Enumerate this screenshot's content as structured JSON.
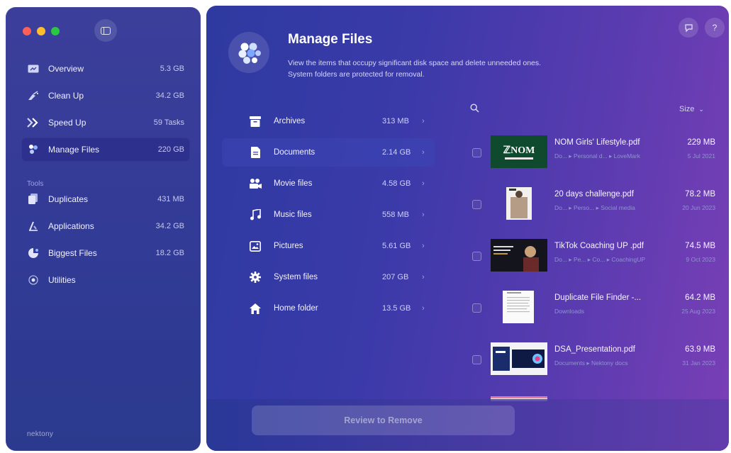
{
  "sidebar": {
    "items": [
      {
        "label": "Overview",
        "value": "5.3 GB",
        "icon": "overview-icon"
      },
      {
        "label": "Clean Up",
        "value": "34.2 GB",
        "icon": "broom-icon"
      },
      {
        "label": "Speed Up",
        "value": "59 Tasks",
        "icon": "speed-icon"
      },
      {
        "label": "Manage Files",
        "value": "220 GB",
        "icon": "manage-files-icon",
        "active": true
      }
    ],
    "tools_label": "Tools",
    "tools": [
      {
        "label": "Duplicates",
        "value": "431 MB",
        "icon": "duplicates-icon"
      },
      {
        "label": "Applications",
        "value": "34.2 GB",
        "icon": "applications-icon"
      },
      {
        "label": "Biggest Files",
        "value": "18.2 GB",
        "icon": "biggest-files-icon"
      },
      {
        "label": "Utilities",
        "value": "",
        "icon": "utilities-icon"
      }
    ],
    "brand": "nektony"
  },
  "header": {
    "title": "Manage Files",
    "subtitle_line1": "View the items that occupy significant disk space and delete unneeded ones.",
    "subtitle_line2": "System folders are protected for removal."
  },
  "categories": [
    {
      "label": "Archives",
      "value": "313 MB",
      "icon": "archive-icon"
    },
    {
      "label": "Documents",
      "value": "2.14 GB",
      "icon": "document-icon",
      "active": true
    },
    {
      "label": "Movie files",
      "value": "4.58 GB",
      "icon": "movie-icon"
    },
    {
      "label": "Music files",
      "value": "558 MB",
      "icon": "music-icon"
    },
    {
      "label": "Pictures",
      "value": "5.61 GB",
      "icon": "picture-icon"
    },
    {
      "label": "System files",
      "value": "207 GB",
      "icon": "gear-icon"
    },
    {
      "label": "Home folder",
      "value": "13.5 GB",
      "icon": "home-icon"
    }
  ],
  "list": {
    "sort_label": "Size",
    "files": [
      {
        "name": "NOM Girls' Lifestyle.pdf",
        "path": "Do... ▸ Personal d... ▸ LoveMark",
        "size": "229 MB",
        "date": "5 Jul 2021"
      },
      {
        "name": "20 days challenge.pdf",
        "path": "Do... ▸ Perso... ▸ Social media",
        "size": "78.2 MB",
        "date": "20 Jun 2023"
      },
      {
        "name": "TikTok Coaching UP .pdf",
        "path": "Do... ▸ Pe... ▸ Co... ▸ CoachingUP",
        "size": "74.5 MB",
        "date": "9 Oct 2023"
      },
      {
        "name": "Duplicate File Finder -...",
        "path": "Downloads",
        "size": "64.2 MB",
        "date": "25 Aug 2023"
      },
      {
        "name": "DSA_Presentation.pdf",
        "path": "Documents ▸ Nektony docs",
        "size": "63.9 MB",
        "date": "31 Jan 2023"
      }
    ]
  },
  "footer": {
    "review_label": "Review to Remove"
  },
  "colors": {
    "accent": "#3a3aa9",
    "sidebar": "#333b97",
    "close": "#ff5f57",
    "minimize": "#febc2e",
    "zoom": "#28c840"
  }
}
